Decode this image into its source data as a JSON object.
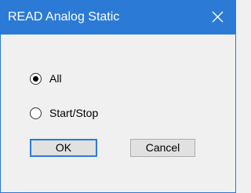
{
  "window": {
    "title": "READ Analog Static",
    "accent_color": "#2b7bd6",
    "close_icon": "close-icon"
  },
  "options": [
    {
      "label": "All",
      "selected": true
    },
    {
      "label": "Start/Stop",
      "selected": false
    }
  ],
  "buttons": {
    "ok_label": "OK",
    "cancel_label": "Cancel"
  }
}
